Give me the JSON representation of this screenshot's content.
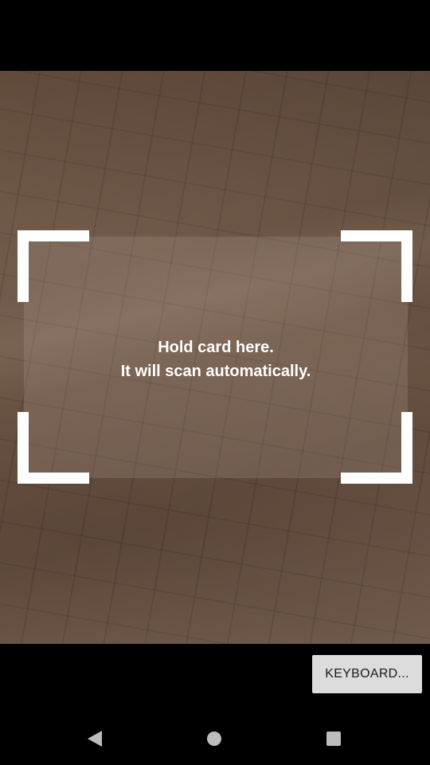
{
  "scanner": {
    "instruction_line1": "Hold card here.",
    "instruction_line2": "It will scan automatically."
  },
  "actions": {
    "keyboard_label": "KEYBOARD..."
  },
  "nav_bar": {
    "back_icon": "back-triangle-icon",
    "home_icon": "home-circle-icon",
    "recents_icon": "recents-square-icon"
  },
  "colors": {
    "frame_corners": "#ffffff",
    "keyboard_button_bg": "#dcdcdc",
    "nav_icons": "#bdbdbd",
    "background": "#000000"
  }
}
